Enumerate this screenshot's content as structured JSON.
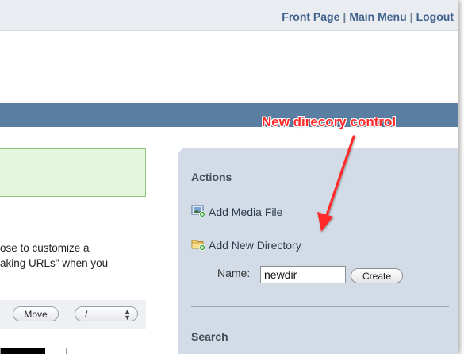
{
  "topnav": {
    "front_page": "Front Page",
    "main_menu": "Main Menu",
    "logout": "Logout",
    "separator": "|"
  },
  "helptext": {
    "line1": "ose to customize a",
    "line2": "aking URLs\" when you"
  },
  "toolbar": {
    "move_label": "Move",
    "path_value": "/"
  },
  "sidebar": {
    "actions_heading": "Actions",
    "add_media": "Add Media File",
    "add_directory": "Add New Directory",
    "name_label": "Name:",
    "name_value": "newdir",
    "create_label": "Create",
    "search_heading": "Search"
  },
  "annotation": {
    "text": "New direcory control"
  },
  "colors": {
    "link": "#41618c",
    "header_bar": "#5b7fa3",
    "sidebar_bg": "#d3dce6",
    "success_bg": "#e4f6dd",
    "annotation": "#ff2a2a"
  },
  "icons": [
    "image-file-add-icon",
    "folder-add-icon",
    "stepper-arrows-icon",
    "annotation-arrow"
  ]
}
